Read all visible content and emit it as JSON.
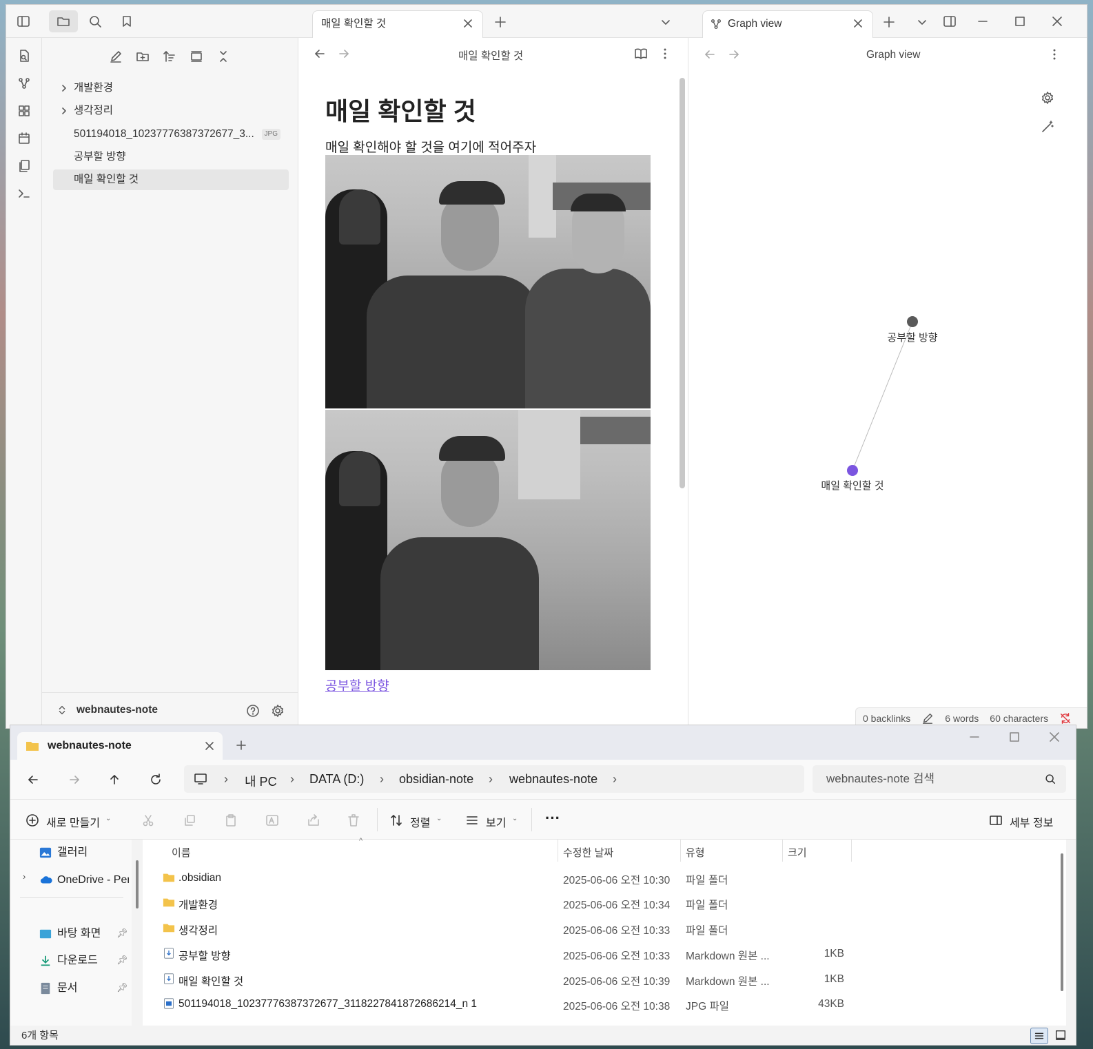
{
  "obsidian": {
    "file_tree": {
      "items": [
        {
          "label": "개발환경"
        },
        {
          "label": "생각정리"
        },
        {
          "label": "501194018_10237776387372677_3...",
          "badge": "JPG"
        },
        {
          "label": "공부할 방향"
        },
        {
          "label": "매일 확인할 것"
        }
      ],
      "vault_name": "webnautes-note"
    },
    "editor": {
      "tab_label": "매일 확인할 것",
      "nav_title": "매일 확인할 것",
      "heading": "매일 확인할 것",
      "body_text": "매일 확인해야 할 것을 여기에 적어주자",
      "link_text": "공부할 방향"
    },
    "graph": {
      "tab_label": "Graph view",
      "nav_title": "Graph view",
      "nodes": [
        {
          "label": "공부할 방향",
          "color": "#5a5a5a"
        },
        {
          "label": "매일 확인할 것",
          "color": "#7b55e0"
        }
      ]
    },
    "status": {
      "backlinks": "0 backlinks",
      "words": "6 words",
      "characters": "60 characters"
    }
  },
  "explorer": {
    "tab_label": "webnautes-note",
    "breadcrumb": [
      "내 PC",
      "DATA (D:)",
      "obsidian-note",
      "webnautes-note"
    ],
    "search_placeholder": "webnautes-note 검색",
    "toolbar": {
      "new_label": "새로 만들기",
      "sort_label": "정렬",
      "view_label": "보기",
      "details_label": "세부 정보"
    },
    "nav": [
      {
        "label": "갤러리"
      },
      {
        "label": "OneDrive - Pers"
      },
      {
        "label": "바탕 화면"
      },
      {
        "label": "다운로드"
      },
      {
        "label": "문서"
      }
    ],
    "columns": {
      "name": "이름",
      "date": "수정한 날짜",
      "type": "유형",
      "size": "크기"
    },
    "rows": [
      {
        "name": ".obsidian",
        "date": "2025-06-06 오전 10:30",
        "type": "파일 폴더",
        "size": ""
      },
      {
        "name": "개발환경",
        "date": "2025-06-06 오전 10:34",
        "type": "파일 폴더",
        "size": ""
      },
      {
        "name": "생각정리",
        "date": "2025-06-06 오전 10:33",
        "type": "파일 폴더",
        "size": ""
      },
      {
        "name": "공부할 방향",
        "date": "2025-06-06 오전 10:33",
        "type": "Markdown 원본 ...",
        "size": "1KB"
      },
      {
        "name": "매일 확인할 것",
        "date": "2025-06-06 오전 10:39",
        "type": "Markdown 원본 ...",
        "size": "1KB"
      },
      {
        "name": "501194018_10237776387372677_3118227841872686214_n 1",
        "date": "2025-06-06 오전 10:38",
        "type": "JPG 파일",
        "size": "43KB"
      }
    ],
    "status_text": "6개 항목"
  }
}
